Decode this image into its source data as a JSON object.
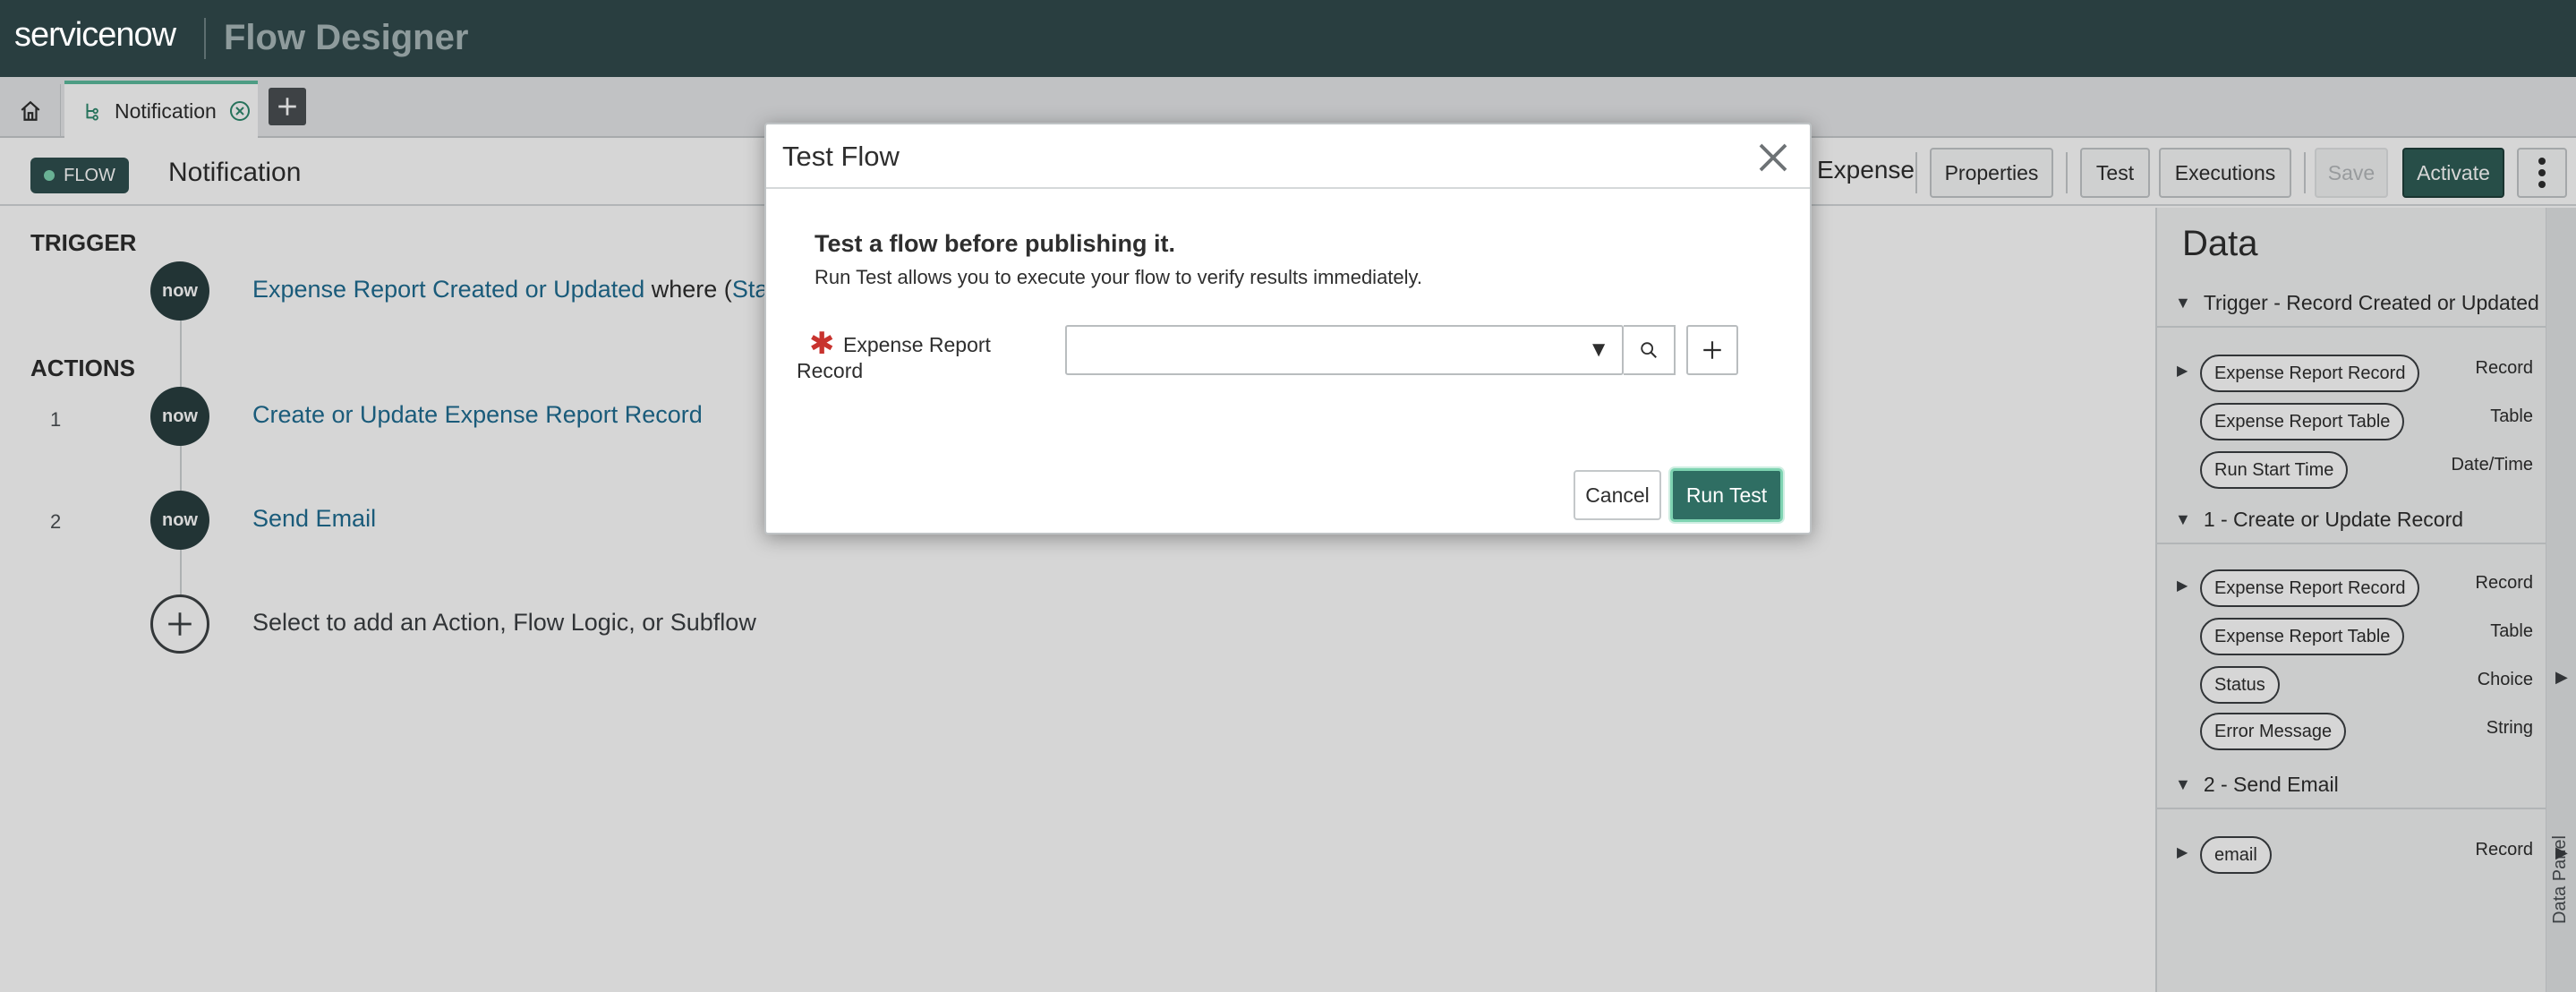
{
  "header": {
    "logo": "servicenow",
    "app_title": "Flow Designer"
  },
  "tabs": {
    "active_label": "Notification"
  },
  "flow_header": {
    "badge": "FLOW",
    "flow_name": "Notification",
    "breadcrumb": "Expense",
    "buttons": {
      "properties": "Properties",
      "test": "Test",
      "executions": "Executions",
      "save": "Save",
      "activate": "Activate"
    }
  },
  "canvas": {
    "trigger_label": "TRIGGER",
    "actions_label": "ACTIONS",
    "node_logo": "now",
    "trigger": {
      "link": "Expense Report Created or Updated",
      "where": " where (",
      "cond": "State is"
    },
    "steps": [
      {
        "num": "1",
        "label": "Create or Update Expense Report Record"
      },
      {
        "num": "2",
        "label": "Send Email"
      }
    ],
    "add_prompt": "Select to add an Action, Flow Logic, or Subflow"
  },
  "data_panel": {
    "title": "Data",
    "side_label": "Data Panel",
    "sections": [
      {
        "title": "Trigger - Record Created or Updated",
        "items": [
          {
            "pill": "Expense Report Record",
            "type": "Record"
          },
          {
            "pill": "Expense Report Table",
            "type": "Table"
          },
          {
            "pill": "Run Start Time",
            "type": "Date/Time"
          }
        ]
      },
      {
        "title": "1 - Create or Update Record",
        "items": [
          {
            "pill": "Expense Report Record",
            "type": "Record"
          },
          {
            "pill": "Expense Report Table",
            "type": "Table"
          },
          {
            "pill": "Status",
            "type": "Choice"
          },
          {
            "pill": "Error Message",
            "type": "String"
          }
        ]
      },
      {
        "title": "2 - Send Email",
        "items": [
          {
            "pill": "email",
            "type": "Record"
          }
        ]
      }
    ]
  },
  "modal": {
    "title": "Test Flow",
    "heading": "Test a flow before publishing it.",
    "subtext": "Run Test allows you to execute your flow to verify results immediately.",
    "field_label": "Expense Report Record",
    "field_value": "",
    "cancel": "Cancel",
    "run": "Run Test"
  },
  "colors": {
    "header_bg": "#293e40",
    "accent": "#2f6e63",
    "link": "#1f6d92",
    "required": "#c8332e"
  }
}
